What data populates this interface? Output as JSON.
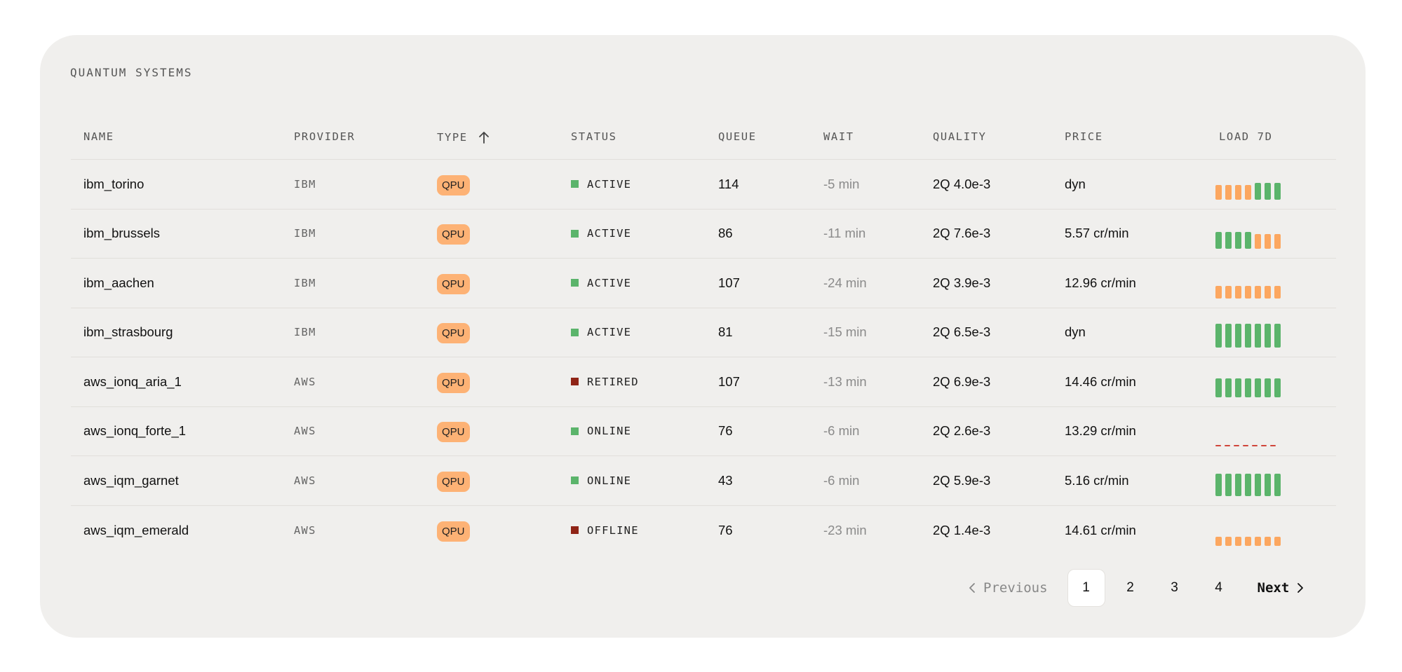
{
  "card": {
    "title": "QUANTUM SYSTEMS"
  },
  "columns": {
    "name": "NAME",
    "provider": "PROVIDER",
    "type": "TYPE",
    "status": "STATUS",
    "queue": "QUEUE",
    "wait": "WAIT",
    "quality": "QUALITY",
    "price": "PRICE",
    "load": "LOAD 7D"
  },
  "sort": {
    "column": "type",
    "direction": "ascending",
    "icon": "arrow-up-icon"
  },
  "colors": {
    "green": "#5bb46b",
    "orange": "#fca760",
    "red": "#b03a2e",
    "dark_red": "#8f2416",
    "badge": "#fdb275"
  },
  "rows": [
    {
      "name": "ibm_torino",
      "provider": "IBM",
      "type": "QPU",
      "status": "ACTIVE",
      "status_color": "#5bb46b",
      "queue": "114",
      "wait": "-5 min",
      "quality": "2Q 4.0e-3",
      "price": "dyn",
      "load": [
        {
          "v": 0.63,
          "c": "#fca760"
        },
        {
          "v": 0.63,
          "c": "#fca760"
        },
        {
          "v": 0.63,
          "c": "#fca760"
        },
        {
          "v": 0.63,
          "c": "#fca760"
        },
        {
          "v": 0.72,
          "c": "#5bb46b"
        },
        {
          "v": 0.72,
          "c": "#5bb46b"
        },
        {
          "v": 0.72,
          "c": "#5bb46b"
        }
      ]
    },
    {
      "name": "ibm_brussels",
      "provider": "IBM",
      "type": "QPU",
      "status": "ACTIVE",
      "status_color": "#5bb46b",
      "queue": "86",
      "wait": "-11 min",
      "quality": "2Q 7.6e-3",
      "price": "5.57 cr/min",
      "load": [
        {
          "v": 0.72,
          "c": "#5bb46b"
        },
        {
          "v": 0.72,
          "c": "#5bb46b"
        },
        {
          "v": 0.72,
          "c": "#5bb46b"
        },
        {
          "v": 0.72,
          "c": "#5bb46b"
        },
        {
          "v": 0.63,
          "c": "#fca760"
        },
        {
          "v": 0.63,
          "c": "#fca760"
        },
        {
          "v": 0.63,
          "c": "#fca760"
        }
      ]
    },
    {
      "name": "ibm_aachen",
      "provider": "IBM",
      "type": "QPU",
      "status": "ACTIVE",
      "status_color": "#5bb46b",
      "queue": "107",
      "wait": "-24 min",
      "quality": "2Q 3.9e-3",
      "price": "12.96 cr/min",
      "load": [
        {
          "v": 0.52,
          "c": "#fca760"
        },
        {
          "v": 0.52,
          "c": "#fca760"
        },
        {
          "v": 0.52,
          "c": "#fca760"
        },
        {
          "v": 0.52,
          "c": "#fca760"
        },
        {
          "v": 0.52,
          "c": "#fca760"
        },
        {
          "v": 0.52,
          "c": "#fca760"
        },
        {
          "v": 0.52,
          "c": "#fca760"
        }
      ]
    },
    {
      "name": "ibm_strasbourg",
      "provider": "IBM",
      "type": "QPU",
      "status": "ACTIVE",
      "status_color": "#5bb46b",
      "queue": "81",
      "wait": "-15 min",
      "quality": "2Q 6.5e-3",
      "price": "dyn",
      "load": [
        {
          "v": 1.0,
          "c": "#5bb46b"
        },
        {
          "v": 1.0,
          "c": "#5bb46b"
        },
        {
          "v": 1.0,
          "c": "#5bb46b"
        },
        {
          "v": 1.0,
          "c": "#5bb46b"
        },
        {
          "v": 1.0,
          "c": "#5bb46b"
        },
        {
          "v": 1.0,
          "c": "#5bb46b"
        },
        {
          "v": 1.0,
          "c": "#5bb46b"
        }
      ]
    },
    {
      "name": "aws_ionq_aria_1",
      "provider": "AWS",
      "type": "QPU",
      "status": "RETIRED",
      "status_color": "#8f2416",
      "queue": "107",
      "wait": "-13 min",
      "quality": "2Q 6.9e-3",
      "price": "14.46 cr/min",
      "load": [
        {
          "v": 0.78,
          "c": "#5bb46b"
        },
        {
          "v": 0.78,
          "c": "#5bb46b"
        },
        {
          "v": 0.78,
          "c": "#5bb46b"
        },
        {
          "v": 0.78,
          "c": "#5bb46b"
        },
        {
          "v": 0.78,
          "c": "#5bb46b"
        },
        {
          "v": 0.78,
          "c": "#5bb46b"
        },
        {
          "v": 0.78,
          "c": "#5bb46b"
        }
      ]
    },
    {
      "name": "aws_ionq_forte_1",
      "provider": "AWS",
      "type": "QPU",
      "status": "ONLINE",
      "status_color": "#5bb46b",
      "queue": "76",
      "wait": "-6 min",
      "quality": "2Q 2.6e-3",
      "price": "13.29 cr/min",
      "load": [
        {
          "v": 0.04,
          "c": "#d0453a"
        },
        {
          "v": 0.04,
          "c": "#d0453a"
        },
        {
          "v": 0.04,
          "c": "#d0453a"
        },
        {
          "v": 0.05,
          "c": "#d0453a"
        },
        {
          "v": 0.06,
          "c": "#d0453a"
        },
        {
          "v": 0.07,
          "c": "#d0453a"
        },
        {
          "v": 0.07,
          "c": "#d0453a"
        }
      ]
    },
    {
      "name": "aws_iqm_garnet",
      "provider": "AWS",
      "type": "QPU",
      "status": "ONLINE",
      "status_color": "#5bb46b",
      "queue": "43",
      "wait": "-6 min",
      "quality": "2Q 5.9e-3",
      "price": "5.16 cr/min",
      "load": [
        {
          "v": 0.93,
          "c": "#5bb46b"
        },
        {
          "v": 0.93,
          "c": "#5bb46b"
        },
        {
          "v": 0.93,
          "c": "#5bb46b"
        },
        {
          "v": 0.93,
          "c": "#5bb46b"
        },
        {
          "v": 0.93,
          "c": "#5bb46b"
        },
        {
          "v": 0.93,
          "c": "#5bb46b"
        },
        {
          "v": 0.93,
          "c": "#5bb46b"
        }
      ]
    },
    {
      "name": "aws_iqm_emerald",
      "provider": "AWS",
      "type": "QPU",
      "status": "OFFLINE",
      "status_color": "#8f2416",
      "queue": "76",
      "wait": "-23 min",
      "quality": "2Q 1.4e-3",
      "price": "14.61 cr/min",
      "load": [
        {
          "v": 0.38,
          "c": "#fca760"
        },
        {
          "v": 0.38,
          "c": "#fca760"
        },
        {
          "v": 0.38,
          "c": "#fca760"
        },
        {
          "v": 0.38,
          "c": "#fca760"
        },
        {
          "v": 0.38,
          "c": "#fca760"
        },
        {
          "v": 0.38,
          "c": "#fca760"
        },
        {
          "v": 0.38,
          "c": "#fca760"
        }
      ]
    }
  ],
  "pagination": {
    "previous_label": "Previous",
    "next_label": "Next",
    "pages": [
      "1",
      "2",
      "3",
      "4"
    ],
    "current": "1",
    "prev_icon": "chevron-left-icon",
    "next_icon": "chevron-right-icon"
  }
}
